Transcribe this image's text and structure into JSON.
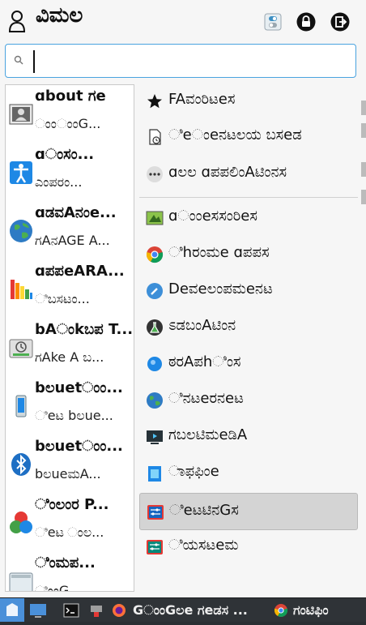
{
  "header": {
    "user_name": "ವಿಮಲ",
    "icons": {
      "user": "user-icon",
      "settings": "settings-icon",
      "lock": "lock-icon",
      "leave": "leave-icon"
    }
  },
  "search": {
    "value": "",
    "placeholder": ""
  },
  "favorites": [
    {
      "title": "ɑbout ಗe",
      "subtitle": "ಂಂಂಂG...",
      "icon": "about-me-icon"
    },
    {
      "title": "ɑಂಸಂ...",
      "subtitle": "ಎಂಪರಂ...",
      "icon": "accessibility-icon"
    },
    {
      "title": "ɑಡವAನಂe...",
      "subtitle": "ಗAನAGE A...",
      "icon": "network-globe-icon"
    },
    {
      "title": "ɑಪಪeARA...",
      "subtitle": "ಿಬಸಟಂ...",
      "icon": "appearance-icon"
    },
    {
      "title": "bAಂkಬಪ T...",
      "subtitle": "ಗAke A ಬ...",
      "icon": "backup-icon"
    },
    {
      "title": "bಲuetಂಂ...",
      "subtitle": "ಿeಟ bಲue...",
      "icon": "bluetooth-phone-icon"
    },
    {
      "title": "bಲuetಂಂ...",
      "subtitle": "bಲueಮA...",
      "icon": "bluetooth-icon"
    },
    {
      "title": "ಿಂಲಂರ P...",
      "subtitle": "ಿeಟ ಂಲ...",
      "icon": "color-icon"
    },
    {
      "title": "ಿಂಮಪ...",
      "subtitle": "ಿಂಂG...",
      "icon": "composite-icon"
    }
  ],
  "categories": [
    {
      "label": "FAವಂರಿಟeಸ",
      "icon": "star-icon",
      "selected": false
    },
    {
      "label": "ಿeಂeನಟಲಯ ಬಸeಡ",
      "icon": "recent-icon",
      "selected": false
    },
    {
      "label": "ɑಲಲ ɑಪಪಲಿಂAಟಿಂನಸ",
      "icon": "more-icon",
      "selected": false
    },
    {
      "label": "ɑಂಂeಸಸಂರಿeಸ",
      "icon": "accessories-icon",
      "selected": false
    },
    {
      "label": "ಿhರಂಮe ɑಪಪಸ",
      "icon": "chrome-icon",
      "selected": false
    },
    {
      "label": "Deವeಲಂಪಮeನಟ",
      "icon": "development-icon",
      "selected": false
    },
    {
      "label": "ಽಡಬಂAಟಿಂನ",
      "icon": "education-icon",
      "selected": false
    },
    {
      "label": "ಠರAಪhಿಂಸ",
      "icon": "graphics-icon",
      "selected": false
    },
    {
      "label": "ಿನಟeರನeಟ",
      "icon": "internet-icon",
      "selected": false
    },
    {
      "label": "ಗಬಲಟಿಮeಡಿA",
      "icon": "multimedia-icon",
      "selected": false
    },
    {
      "label": "ಾಫಫಿಂe",
      "icon": "office-icon",
      "selected": false
    },
    {
      "label": "ಿeಟಟಿನGಸ",
      "icon": "settings-app-icon",
      "selected": true
    },
    {
      "label": "ಿಯಸಟeಮ",
      "icon": "system-icon",
      "selected": false
    }
  ],
  "taskbar": {
    "window1": "GಂಂGಲe ಗeಡಸ ...",
    "window2": "ಗಂಟಿಫಿಂ"
  },
  "colors": {
    "accent": "#4aa3df",
    "selected": "#d4d4d4",
    "taskbar": "#2f3337"
  }
}
